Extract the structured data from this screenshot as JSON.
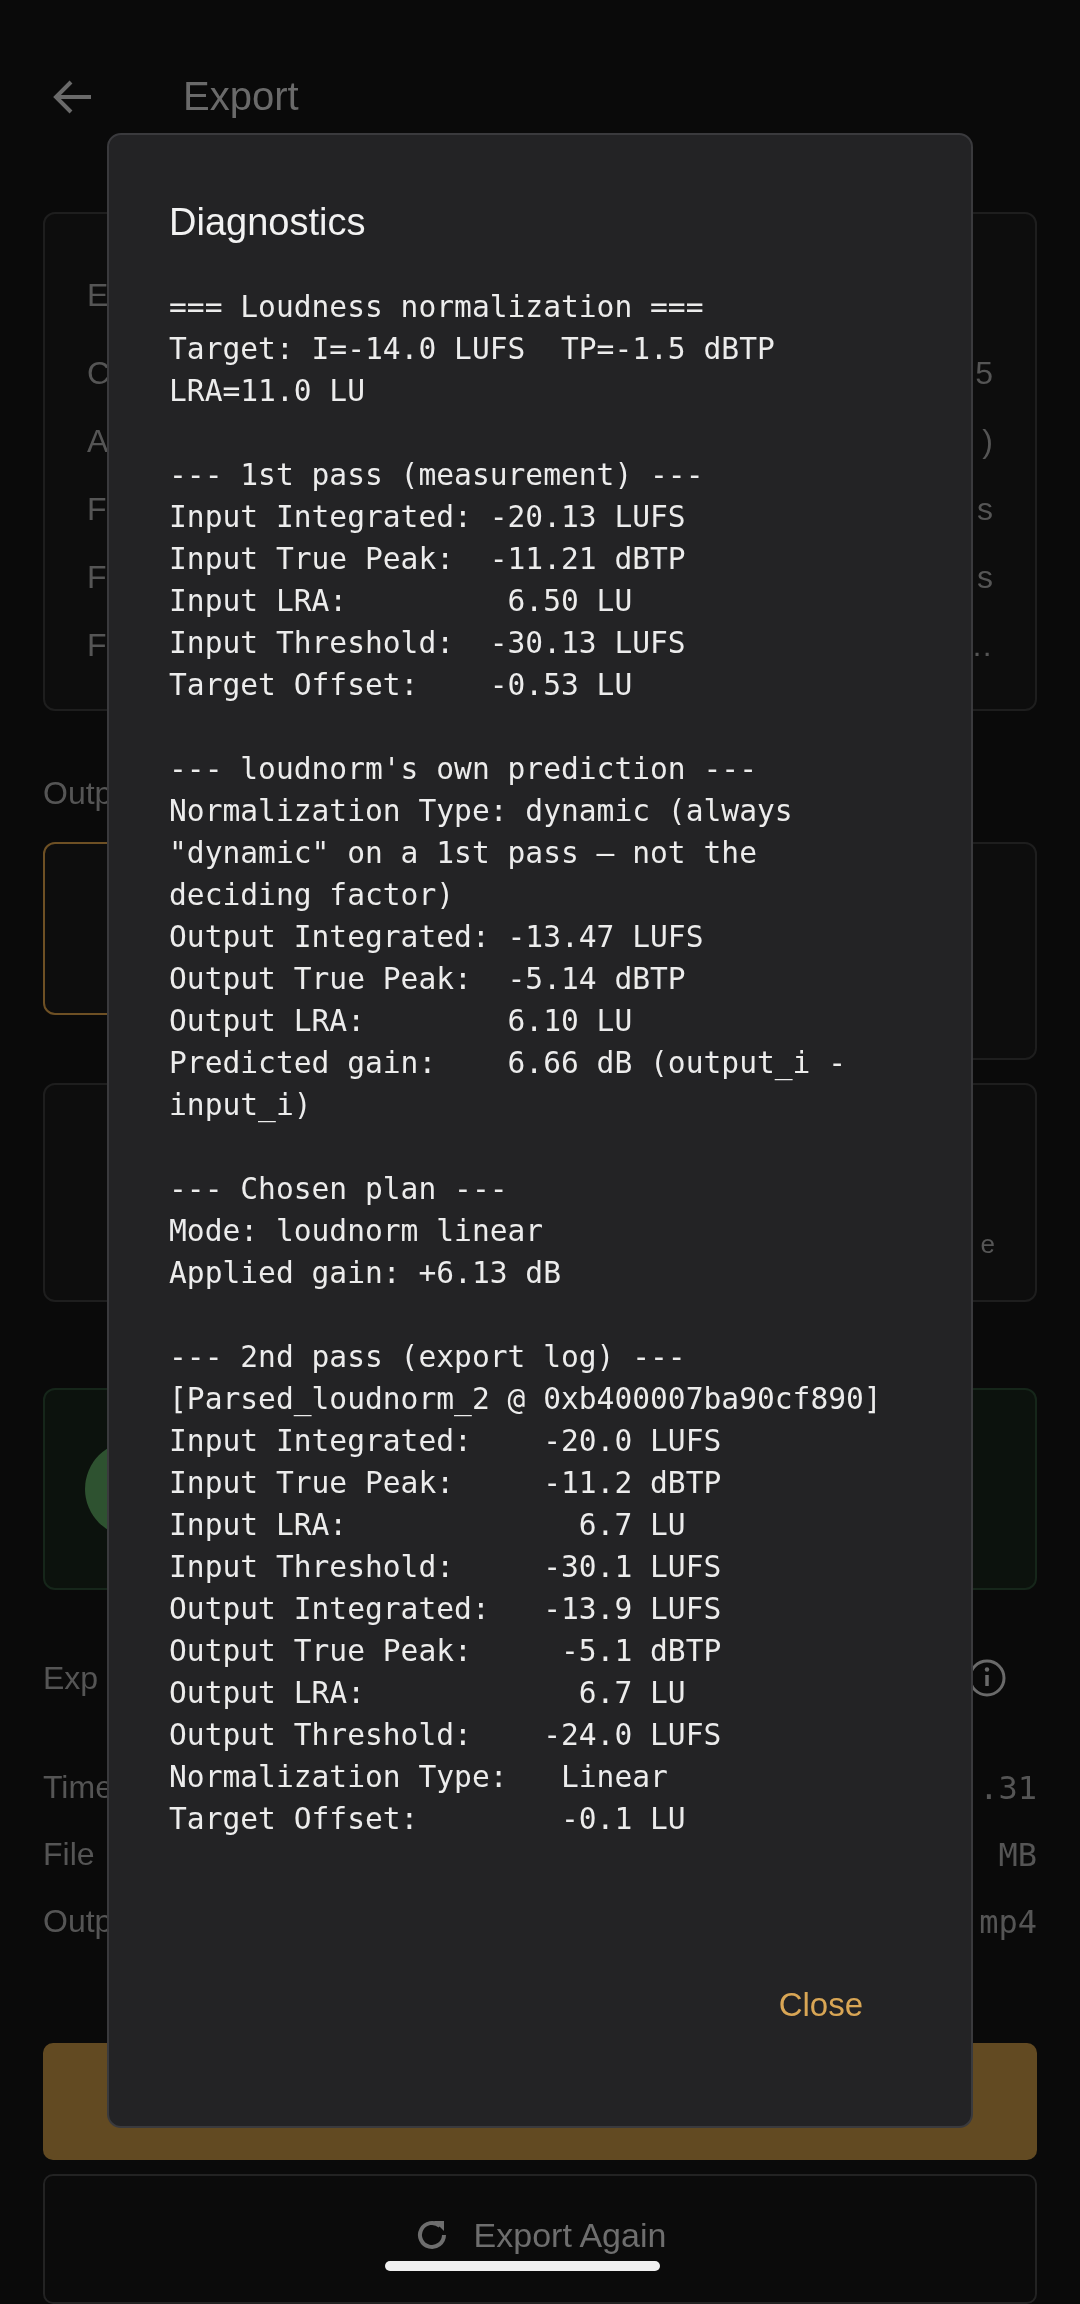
{
  "header": {
    "title": "Export"
  },
  "summary_card": {
    "heading": "E",
    "rows": [
      {
        "label": "C",
        "value": "5"
      },
      {
        "label": "A",
        "value": ")"
      },
      {
        "label": "F",
        "value": "s"
      },
      {
        "label": "F",
        "value": "s"
      },
      {
        "label": "F",
        "value": "…"
      }
    ]
  },
  "output_section": {
    "label": "Outp",
    "options": [
      {
        "selected": true
      },
      {
        "selected": false
      }
    ]
  },
  "notice_card": {
    "text": "e"
  },
  "export_info": {
    "label": "Exp",
    "rows": [
      {
        "label": "Time",
        "value": ".31"
      },
      {
        "label": "File",
        "value": "MB"
      },
      {
        "label": "Outp",
        "value": "mp4"
      }
    ]
  },
  "export_again_button": {
    "label": "Export Again"
  },
  "dialog": {
    "title": "Diagnostics",
    "sections": [
      {
        "lines": [
          "=== Loudness normalization ===",
          "Target: I=-14.0 LUFS  TP=-1.5 dBTP LRA=11.0 LU"
        ]
      },
      {
        "lines": [
          "--- 1st pass (measurement) ---",
          "Input Integrated: -20.13 LUFS",
          "Input True Peak:  -11.21 dBTP",
          "Input LRA:         6.50 LU",
          "Input Threshold:  -30.13 LUFS",
          "Target Offset:    -0.53 LU"
        ]
      },
      {
        "lines": [
          "--- loudnorm's own prediction ---",
          "Normalization Type: dynamic (always \"dynamic\" on a 1st pass — not the deciding factor)",
          "Output Integrated: -13.47 LUFS",
          "Output True Peak:  -5.14 dBTP",
          "Output LRA:        6.10 LU",
          "Predicted gain:    6.66 dB (output_i - input_i)"
        ]
      },
      {
        "lines": [
          "--- Chosen plan ---",
          "Mode: loudnorm linear",
          "Applied gain: +6.13 dB"
        ]
      },
      {
        "lines": [
          "--- 2nd pass (export log) ---",
          "[Parsed_loudnorm_2 @ 0xb400007ba90cf890]",
          "Input Integrated:    -20.0 LUFS",
          "Input True Peak:     -11.2 dBTP",
          "Input LRA:             6.7 LU",
          "Input Threshold:     -30.1 LUFS",
          "Output Integrated:   -13.9 LUFS",
          "Output True Peak:     -5.1 dBTP",
          "Output LRA:            6.7 LU",
          "Output Threshold:    -24.0 LUFS",
          "Normalization Type:   Linear",
          "Target Offset:        -0.1 LU"
        ]
      }
    ],
    "close": "Close"
  }
}
